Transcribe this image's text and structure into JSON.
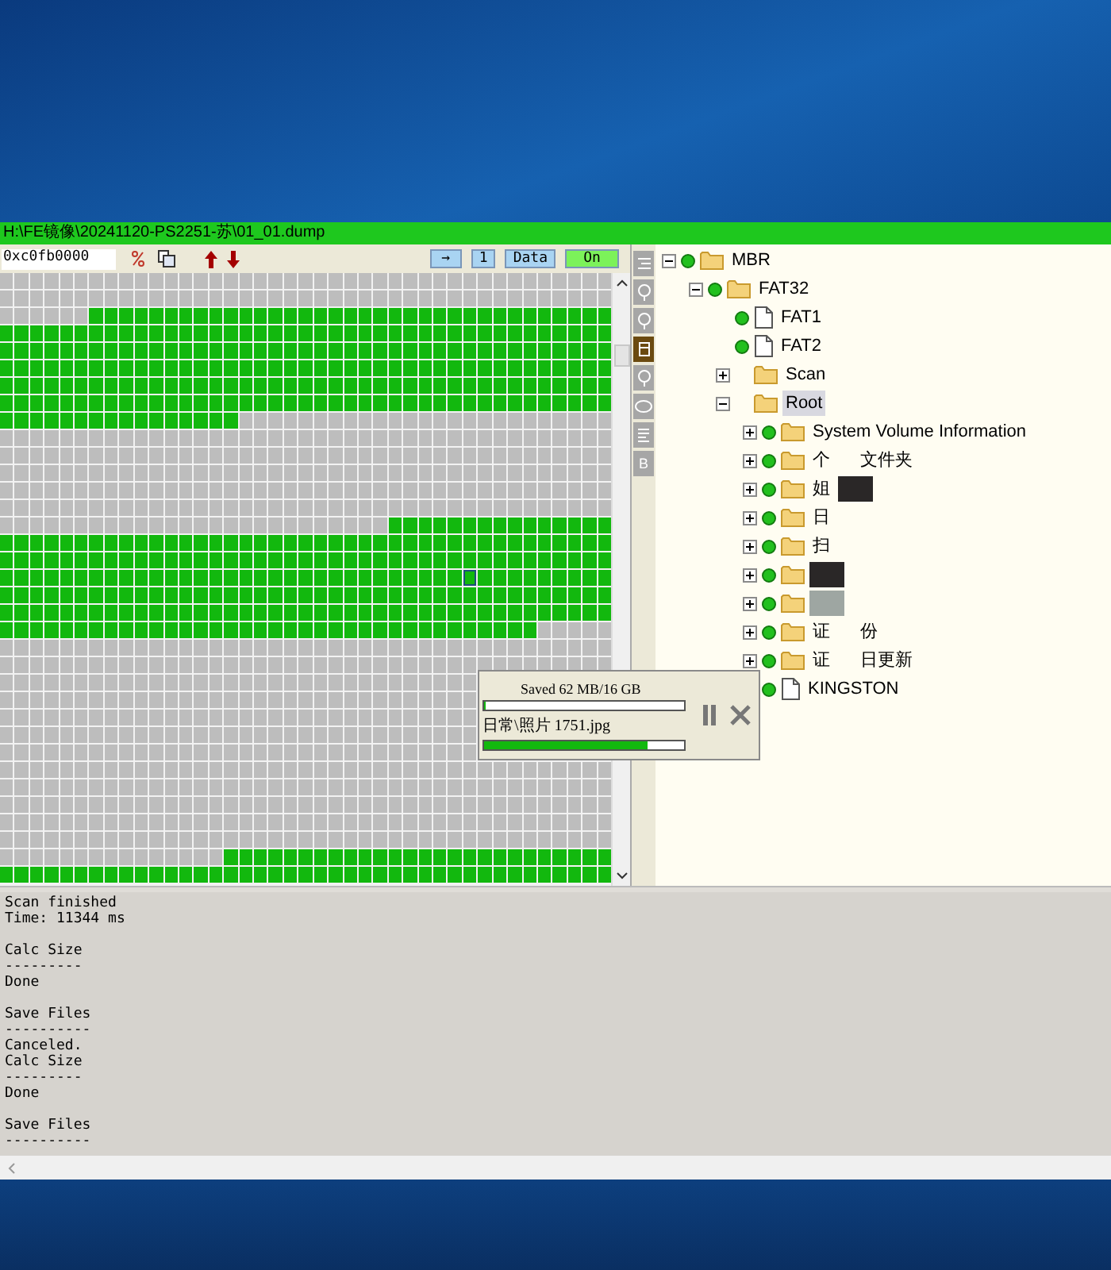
{
  "window": {
    "title": "H:\\FE镜像\\20241120-PS2251-苏\\01_01.dump"
  },
  "toolbar": {
    "address": "0xc0fb0000",
    "buttons": [
      {
        "label": "→",
        "kind": "blue"
      },
      {
        "label": "1",
        "kind": "blue"
      },
      {
        "label": "Data",
        "kind": "blue"
      },
      {
        "label": "On",
        "kind": "green"
      }
    ]
  },
  "cluster_map": {
    "rows": [
      {
        "used": [
          false,
          false,
          false,
          false,
          false,
          false,
          false,
          false,
          false,
          false,
          false,
          false,
          false,
          false,
          false,
          false,
          false,
          false,
          false,
          false,
          false,
          false,
          false,
          false,
          false,
          false,
          false,
          false,
          false,
          false,
          false,
          false,
          false,
          false,
          false,
          false,
          false,
          false,
          false,
          false,
          false
        ]
      },
      {
        "used": [
          false,
          false,
          false,
          false,
          false,
          false,
          false,
          false,
          false,
          false,
          false,
          false,
          false,
          false,
          false,
          false,
          false,
          false,
          false,
          false,
          false,
          false,
          false,
          false,
          false,
          false,
          false,
          false,
          false,
          false,
          false,
          false,
          false,
          false,
          false,
          false,
          false,
          false,
          false,
          false,
          false
        ]
      },
      {
        "used": [
          false,
          false,
          false,
          false,
          false,
          false,
          true,
          true,
          true,
          true,
          true,
          true,
          true,
          true,
          true,
          true,
          true,
          true,
          true,
          true,
          true,
          true,
          true,
          true,
          true,
          true,
          true,
          true,
          true,
          true,
          true,
          true,
          true,
          true,
          true,
          true,
          true,
          true,
          true,
          true,
          true
        ]
      },
      {
        "used": [
          true,
          true,
          true,
          true,
          true,
          true,
          true,
          true,
          true,
          true,
          true,
          true,
          true,
          true,
          true,
          true,
          true,
          true,
          true,
          true,
          true,
          true,
          true,
          true,
          true,
          true,
          true,
          true,
          true,
          true,
          true,
          true,
          true,
          true,
          true,
          true,
          true,
          true,
          true,
          true,
          true
        ]
      },
      {
        "used": [
          true,
          true,
          true,
          true,
          true,
          true,
          true,
          true,
          true,
          true,
          true,
          true,
          true,
          true,
          true,
          true,
          true,
          true,
          true,
          true,
          true,
          true,
          true,
          true,
          true,
          true,
          true,
          true,
          true,
          true,
          true,
          true,
          true,
          true,
          true,
          true,
          true,
          true,
          true,
          true,
          true
        ]
      },
      {
        "used": [
          true,
          true,
          true,
          true,
          true,
          true,
          true,
          true,
          true,
          true,
          true,
          true,
          true,
          true,
          true,
          true,
          true,
          true,
          true,
          true,
          true,
          true,
          true,
          true,
          true,
          true,
          true,
          true,
          true,
          true,
          true,
          true,
          true,
          true,
          true,
          true,
          true,
          true,
          true,
          true,
          true
        ]
      },
      {
        "used": [
          true,
          true,
          true,
          true,
          true,
          true,
          true,
          true,
          true,
          true,
          true,
          true,
          true,
          true,
          true,
          true,
          true,
          true,
          true,
          true,
          true,
          true,
          true,
          true,
          true,
          true,
          true,
          true,
          true,
          true,
          true,
          true,
          true,
          true,
          true,
          true,
          true,
          true,
          true,
          true,
          true
        ]
      },
      {
        "used": [
          true,
          true,
          true,
          true,
          true,
          true,
          true,
          true,
          true,
          true,
          true,
          true,
          true,
          true,
          true,
          true,
          true,
          true,
          true,
          true,
          true,
          true,
          true,
          true,
          true,
          true,
          true,
          true,
          true,
          true,
          true,
          true,
          true,
          true,
          true,
          true,
          true,
          true,
          true,
          true,
          true
        ]
      },
      {
        "used": [
          true,
          true,
          true,
          true,
          true,
          true,
          true,
          true,
          true,
          true,
          true,
          true,
          true,
          true,
          true,
          true,
          false,
          false,
          false,
          false,
          false,
          false,
          false,
          false,
          false,
          false,
          false,
          false,
          false,
          false,
          false,
          false,
          false,
          false,
          false,
          false,
          false,
          false,
          false,
          false,
          false
        ]
      },
      {
        "used": [
          false,
          false,
          false,
          false,
          false,
          false,
          false,
          false,
          false,
          false,
          false,
          false,
          false,
          false,
          false,
          false,
          false,
          false,
          false,
          false,
          false,
          false,
          false,
          false,
          false,
          false,
          false,
          false,
          false,
          false,
          false,
          false,
          false,
          false,
          false,
          false,
          false,
          false,
          false,
          false,
          false
        ]
      },
      {
        "used": [
          false,
          false,
          false,
          false,
          false,
          false,
          false,
          false,
          false,
          false,
          false,
          false,
          false,
          false,
          false,
          false,
          false,
          false,
          false,
          false,
          false,
          false,
          false,
          false,
          false,
          false,
          false,
          false,
          false,
          false,
          false,
          false,
          false,
          false,
          false,
          false,
          false,
          false,
          false,
          false,
          false
        ]
      },
      {
        "used": [
          false,
          false,
          false,
          false,
          false,
          false,
          false,
          false,
          false,
          false,
          false,
          false,
          false,
          false,
          false,
          false,
          false,
          false,
          false,
          false,
          false,
          false,
          false,
          false,
          false,
          false,
          false,
          false,
          false,
          false,
          false,
          false,
          false,
          false,
          false,
          false,
          false,
          false,
          false,
          false,
          false
        ]
      },
      {
        "used": [
          false,
          false,
          false,
          false,
          false,
          false,
          false,
          false,
          false,
          false,
          false,
          false,
          false,
          false,
          false,
          false,
          false,
          false,
          false,
          false,
          false,
          false,
          false,
          false,
          false,
          false,
          false,
          false,
          false,
          false,
          false,
          false,
          false,
          false,
          false,
          false,
          false,
          false,
          false,
          false,
          false
        ]
      },
      {
        "used": [
          false,
          false,
          false,
          false,
          false,
          false,
          false,
          false,
          false,
          false,
          false,
          false,
          false,
          false,
          false,
          false,
          false,
          false,
          false,
          false,
          false,
          false,
          false,
          false,
          false,
          false,
          false,
          false,
          false,
          false,
          false,
          false,
          false,
          false,
          false,
          false,
          false,
          false,
          false,
          false,
          false
        ]
      },
      {
        "used": [
          false,
          false,
          false,
          false,
          false,
          false,
          false,
          false,
          false,
          false,
          false,
          false,
          false,
          false,
          false,
          false,
          false,
          false,
          false,
          false,
          false,
          false,
          false,
          false,
          false,
          false,
          true,
          true,
          true,
          true,
          true,
          true,
          true,
          true,
          true,
          true,
          true,
          true,
          true,
          true,
          true
        ]
      },
      {
        "used": [
          true,
          true,
          true,
          true,
          true,
          true,
          true,
          true,
          true,
          true,
          true,
          true,
          true,
          true,
          true,
          true,
          true,
          true,
          true,
          true,
          true,
          true,
          true,
          true,
          true,
          true,
          true,
          true,
          true,
          true,
          true,
          true,
          true,
          true,
          true,
          true,
          true,
          true,
          true,
          true,
          true
        ]
      },
      {
        "used": [
          true,
          true,
          true,
          true,
          true,
          true,
          true,
          true,
          true,
          true,
          true,
          true,
          true,
          true,
          true,
          true,
          true,
          true,
          true,
          true,
          true,
          true,
          true,
          true,
          true,
          true,
          true,
          true,
          true,
          true,
          true,
          true,
          true,
          true,
          true,
          true,
          true,
          true,
          true,
          true,
          true
        ]
      },
      {
        "used": [
          true,
          true,
          true,
          true,
          true,
          true,
          true,
          true,
          true,
          true,
          true,
          true,
          true,
          true,
          true,
          true,
          true,
          true,
          true,
          true,
          true,
          true,
          true,
          true,
          true,
          true,
          true,
          true,
          true,
          true,
          true,
          true,
          true,
          true,
          true,
          true,
          true,
          true,
          true,
          true,
          true
        ],
        "cursor": [
          false,
          false,
          false,
          false,
          false,
          false,
          false,
          false,
          false,
          false,
          false,
          false,
          false,
          false,
          false,
          false,
          false,
          false,
          false,
          false,
          false,
          false,
          false,
          false,
          false,
          false,
          false,
          false,
          false,
          false,
          false,
          true,
          false,
          false,
          false,
          false,
          false,
          false,
          false,
          false,
          false
        ]
      },
      {
        "used": [
          true,
          true,
          true,
          true,
          true,
          true,
          true,
          true,
          true,
          true,
          true,
          true,
          true,
          true,
          true,
          true,
          true,
          true,
          true,
          true,
          true,
          true,
          true,
          true,
          true,
          true,
          true,
          true,
          true,
          true,
          true,
          true,
          true,
          true,
          true,
          true,
          true,
          true,
          true,
          true,
          true
        ]
      },
      {
        "used": [
          true,
          true,
          true,
          true,
          true,
          true,
          true,
          true,
          true,
          true,
          true,
          true,
          true,
          true,
          true,
          true,
          true,
          true,
          true,
          true,
          true,
          true,
          true,
          true,
          true,
          true,
          true,
          true,
          true,
          true,
          true,
          true,
          true,
          true,
          true,
          true,
          true,
          true,
          true,
          true,
          true
        ]
      },
      {
        "used": [
          true,
          true,
          true,
          true,
          true,
          true,
          true,
          true,
          true,
          true,
          true,
          true,
          true,
          true,
          true,
          true,
          true,
          true,
          true,
          true,
          true,
          true,
          true,
          true,
          true,
          true,
          true,
          true,
          true,
          true,
          true,
          true,
          true,
          true,
          true,
          true,
          false,
          false,
          false,
          false,
          false
        ]
      },
      {
        "used": [
          false,
          false,
          false,
          false,
          false,
          false,
          false,
          false,
          false,
          false,
          false,
          false,
          false,
          false,
          false,
          false,
          false,
          false,
          false,
          false,
          false,
          false,
          false,
          false,
          false,
          false,
          false,
          false,
          false,
          false,
          false,
          false,
          false,
          false,
          false,
          false,
          false,
          false,
          false,
          false,
          false
        ]
      },
      {
        "used": [
          false,
          false,
          false,
          false,
          false,
          false,
          false,
          false,
          false,
          false,
          false,
          false,
          false,
          false,
          false,
          false,
          false,
          false,
          false,
          false,
          false,
          false,
          false,
          false,
          false,
          false,
          false,
          false,
          false,
          false,
          false,
          false,
          false,
          false,
          false,
          false,
          false,
          false,
          false,
          false,
          false
        ]
      },
      {
        "used": [
          false,
          false,
          false,
          false,
          false,
          false,
          false,
          false,
          false,
          false,
          false,
          false,
          false,
          false,
          false,
          false,
          false,
          false,
          false,
          false,
          false,
          false,
          false,
          false,
          false,
          false,
          false,
          false,
          false,
          false,
          false,
          false
        ]
      },
      {
        "used": [
          false,
          false,
          false,
          false,
          false,
          false,
          false,
          false,
          false,
          false,
          false,
          false,
          false,
          false,
          false,
          false,
          false,
          false,
          false,
          false,
          false,
          false,
          false,
          false,
          false,
          false,
          false,
          false,
          false,
          false,
          false,
          false
        ]
      },
      {
        "used": [
          false,
          false,
          false,
          false,
          false,
          false,
          false,
          false,
          false,
          false,
          false,
          false,
          false,
          false,
          false,
          false,
          false,
          false,
          false,
          false,
          false,
          false,
          false,
          false,
          false,
          false,
          false,
          false,
          false,
          false,
          false,
          false
        ]
      },
      {
        "used": [
          false,
          false,
          false,
          false,
          false,
          false,
          false,
          false,
          false,
          false,
          false,
          false,
          false,
          false,
          false,
          false,
          false,
          false,
          false,
          false,
          false,
          false,
          false,
          false,
          false,
          false,
          false,
          false,
          false,
          false,
          false,
          false
        ]
      },
      {
        "used": [
          false,
          false,
          false,
          false,
          false,
          false,
          false,
          false,
          false,
          false,
          false,
          false,
          false,
          false,
          false,
          false,
          false,
          false,
          false,
          false,
          false,
          false,
          false,
          false,
          false,
          false,
          false,
          false,
          false,
          false,
          false,
          false
        ]
      },
      {
        "used": [
          false,
          false,
          false,
          false,
          false,
          false,
          false,
          false,
          false,
          false,
          false,
          false,
          false,
          false,
          false,
          false,
          false,
          false,
          false,
          false,
          false,
          false,
          false,
          false,
          false,
          false,
          false,
          false,
          false,
          false,
          false,
          false,
          false,
          false,
          false,
          false,
          false,
          false,
          false,
          false,
          false
        ]
      },
      {
        "used": [
          false,
          false,
          false,
          false,
          false,
          false,
          false,
          false,
          false,
          false,
          false,
          false,
          false,
          false,
          false,
          false,
          false,
          false,
          false,
          false,
          false,
          false,
          false,
          false,
          false,
          false,
          false,
          false,
          false,
          false,
          false,
          false,
          false,
          false,
          false,
          false,
          false,
          false,
          false,
          false,
          false
        ]
      },
      {
        "used": [
          false,
          false,
          false,
          false,
          false,
          false,
          false,
          false,
          false,
          false,
          false,
          false,
          false,
          false,
          false,
          false,
          false,
          false,
          false,
          false,
          false,
          false,
          false,
          false,
          false,
          false,
          false,
          false,
          false,
          false,
          false,
          false,
          false,
          false,
          false,
          false,
          false,
          false,
          false,
          false,
          false
        ]
      },
      {
        "used": [
          false,
          false,
          false,
          false,
          false,
          false,
          false,
          false,
          false,
          false,
          false,
          false,
          false,
          false,
          false,
          false,
          false,
          false,
          false,
          false,
          false,
          false,
          false,
          false,
          false,
          false,
          false,
          false,
          false,
          false,
          false,
          false,
          false,
          false,
          false,
          false,
          false,
          false,
          false,
          false,
          false
        ]
      },
      {
        "used": [
          false,
          false,
          false,
          false,
          false,
          false,
          false,
          false,
          false,
          false,
          false,
          false,
          false,
          false,
          false,
          false,
          false,
          false,
          false,
          false,
          false,
          false,
          false,
          false,
          false,
          false,
          false,
          false,
          false,
          false,
          false,
          false,
          false,
          false,
          false,
          false,
          false,
          false,
          false,
          false,
          false
        ]
      },
      {
        "used": [
          false,
          false,
          false,
          false,
          false,
          false,
          false,
          false,
          false,
          false,
          false,
          false,
          false,
          false,
          false,
          true,
          true,
          true,
          true,
          true,
          true,
          true,
          true,
          true,
          true,
          true,
          true,
          true,
          true,
          true,
          true,
          true,
          true,
          true,
          true,
          true,
          true,
          true,
          true,
          true,
          true
        ]
      },
      {
        "used": [
          true,
          true,
          true,
          true,
          true,
          true,
          true,
          true,
          true,
          true,
          true,
          true,
          true,
          true,
          true,
          true,
          true,
          true,
          true,
          true,
          true,
          true,
          true,
          true,
          true,
          true,
          true,
          true,
          true,
          true,
          true,
          true,
          true,
          true,
          true,
          true,
          true,
          true,
          true,
          true,
          true
        ]
      }
    ]
  },
  "progress_popup": {
    "saved": "Saved 62 MB/16 GB",
    "saved_bar": {
      "level": 0.01
    },
    "file": "日常\\照片 1751.jpg",
    "file_bar": {
      "level": 0.82
    }
  },
  "tool_strip": [
    {
      "kind": "list",
      "selected": false
    },
    {
      "kind": "bulb",
      "selected": false
    },
    {
      "kind": "bulb",
      "selected": false
    },
    {
      "kind": "scroll",
      "selected": true
    },
    {
      "kind": "bulb",
      "selected": false
    },
    {
      "kind": "ellipse",
      "selected": false
    },
    {
      "kind": "lines",
      "selected": false
    },
    {
      "kind": "letter",
      "label": "B",
      "selected": false
    }
  ],
  "tree": [
    {
      "label": "MBR",
      "kind": "folder",
      "status": true,
      "expanded": true,
      "selected": false,
      "children": [
        {
          "label": "FAT32",
          "kind": "folder",
          "status": true,
          "expanded": true,
          "selected": false,
          "children": [
            {
              "label": "FAT1",
              "kind": "file",
              "status": true,
              "selected": false
            },
            {
              "label": "FAT2",
              "kind": "file",
              "status": true,
              "selected": false
            },
            {
              "label": "Scan",
              "kind": "folder",
              "status": false,
              "expanded": false,
              "selected": false
            },
            {
              "label": "Root",
              "kind": "folder",
              "status": false,
              "expanded": true,
              "selected": true,
              "children": [
                {
                  "label": "System Volume Information",
                  "kind": "folder",
                  "status": true,
                  "expanded": false,
                  "selected": false
                },
                {
                  "label": "个",
                  "label_tail": "文件夹",
                  "kind": "folder",
                  "status": true,
                  "expanded": false,
                  "selected": false
                },
                {
                  "label": "姐",
                  "kind": "folder",
                  "status": true,
                  "expanded": false,
                  "selected": false,
                  "redaction": {
                    "kind": "dark"
                  }
                },
                {
                  "label": "日",
                  "kind": "folder",
                  "status": true,
                  "expanded": false,
                  "selected": false
                },
                {
                  "label": "扫",
                  "kind": "folder",
                  "status": true,
                  "expanded": false,
                  "selected": false
                },
                {
                  "kind": "folder",
                  "status": true,
                  "expanded": false,
                  "selected": false,
                  "redaction": {
                    "kind": "dark"
                  }
                },
                {
                  "kind": "folder",
                  "status": true,
                  "expanded": false,
                  "selected": false,
                  "redaction": {
                    "kind": "gray"
                  }
                },
                {
                  "label": "证",
                  "label_tail": "份",
                  "kind": "folder",
                  "status": true,
                  "expanded": false,
                  "selected": false
                },
                {
                  "label": "证",
                  "label_tail": "日更新",
                  "kind": "folder",
                  "status": true,
                  "expanded": false,
                  "selected": false
                },
                {
                  "label": "KINGSTON",
                  "kind": "file",
                  "status": true,
                  "selected": false
                }
              ]
            }
          ]
        }
      ]
    }
  ],
  "log": [
    [
      "Scan finished",
      "Time: 11344 ms"
    ],
    [
      "Calc Size",
      "---------",
      "Done"
    ],
    [
      "Save Files",
      "----------",
      "Canceled.",
      "Calc Size",
      "---------",
      "Done"
    ],
    [
      "Save Files",
      "----------"
    ]
  ]
}
